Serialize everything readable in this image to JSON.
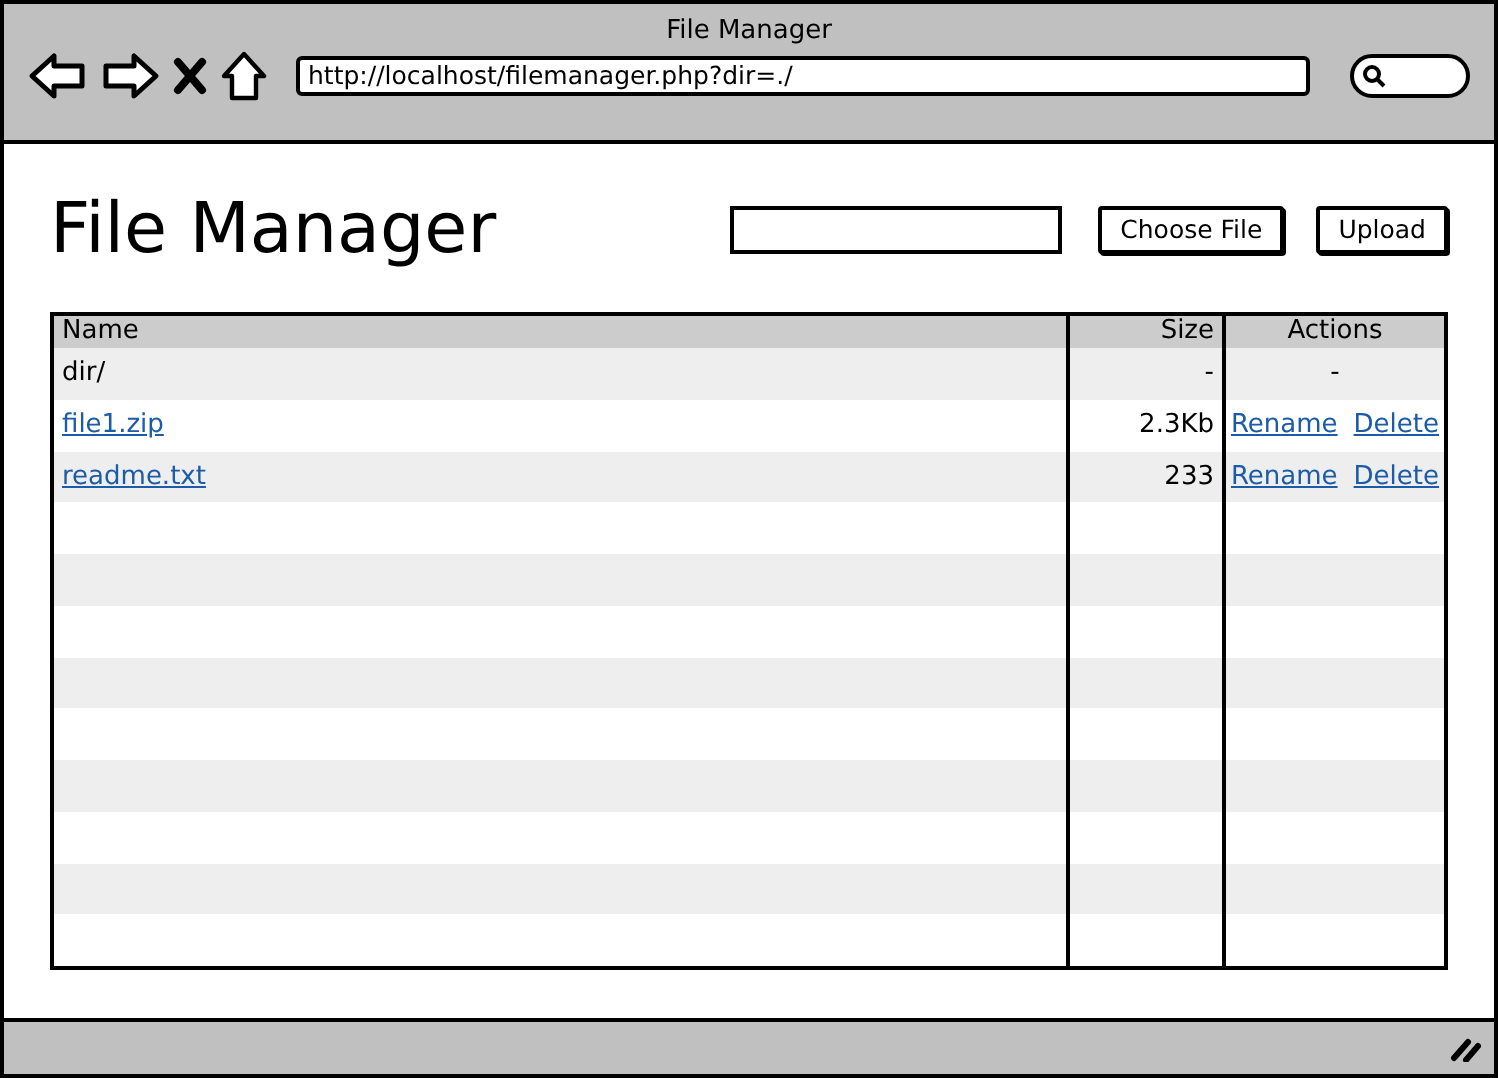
{
  "window": {
    "title": "File Manager"
  },
  "browser": {
    "url": "http://localhost/filemanager.php?dir=./"
  },
  "page": {
    "heading": "File Manager",
    "buttons": [
      "Choose File",
      "Upload"
    ]
  },
  "table": {
    "columns": [
      "Name",
      "Size",
      "Actions"
    ],
    "rows": [
      {
        "name": "dir/",
        "link": false,
        "size": "-",
        "actions": [
          {
            "label": "-",
            "link": false
          }
        ]
      },
      {
        "name": "file1.zip",
        "link": true,
        "size": "2.3Kb",
        "actions": [
          {
            "label": "Rename",
            "link": true
          },
          {
            "label": "Delete",
            "link": true
          }
        ]
      },
      {
        "name": "readme.txt",
        "link": true,
        "size": "233",
        "actions": [
          {
            "label": "Rename",
            "link": true
          },
          {
            "label": "Delete",
            "link": true
          }
        ]
      }
    ]
  }
}
